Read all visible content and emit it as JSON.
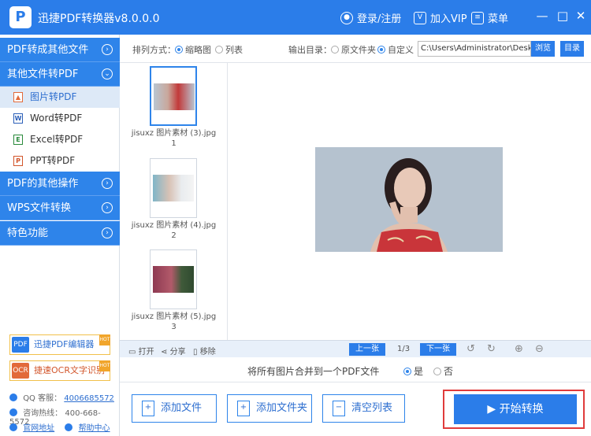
{
  "titlebar": {
    "logo_letter": "P",
    "title": "迅捷PDF转换器v8.0.0.0",
    "login": "登录/注册",
    "vip": "加入VIP",
    "menu": "菜单",
    "win_min": "—",
    "win_max": "□",
    "win_close": "✕"
  },
  "sidebar": {
    "categories": [
      {
        "label": "PDF转成其他文件",
        "chev": "›"
      },
      {
        "label": "其他文件转PDF",
        "chev": "⌄"
      },
      {
        "label": "PDF的其他操作",
        "chev": "›"
      },
      {
        "label": "WPS文件转换",
        "chev": "›"
      },
      {
        "label": "特色功能",
        "chev": "›"
      }
    ],
    "subitems": [
      {
        "label": "图片转PDF",
        "icon": "▲"
      },
      {
        "label": "Word转PDF",
        "icon": "W"
      },
      {
        "label": "Excel转PDF",
        "icon": "E"
      },
      {
        "label": "PPT转PDF",
        "icon": "P"
      }
    ],
    "promos": [
      {
        "label": "迅捷PDF编辑器",
        "icon": "PDF",
        "badge": "HOT"
      },
      {
        "label": "捷速OCR文字识别",
        "icon": "OCR",
        "badge": "HOT"
      }
    ],
    "contact": {
      "qq_label": "QQ 客服：",
      "qq_value": "4006685572",
      "phone_label": "咨询热线：",
      "phone_value": "400-668-5572",
      "site": "官网地址",
      "help": "帮助中心"
    }
  },
  "options": {
    "sort_label": "排列方式：",
    "sort_thumb": "缩略图",
    "sort_list": "列表",
    "out_label": "输出目录：",
    "out_orig": "原文件夹",
    "out_custom": "自定义",
    "path": "C:\\Users\\Administrator\\Desktop",
    "browse": "浏览",
    "dir": "目录"
  },
  "files": [
    {
      "name": "jisuxz 图片素材 (3).jpg",
      "index": "1"
    },
    {
      "name": "jisuxz 图片素材 (4).jpg",
      "index": "2"
    },
    {
      "name": "jisuxz 图片素材 (5).jpg",
      "index": "3"
    }
  ],
  "thumb_tools": {
    "open": "打开",
    "share": "分享",
    "remove": "移除"
  },
  "pager": {
    "prev": "上一张",
    "page": "1/3",
    "next": "下一张"
  },
  "merge": {
    "label": "将所有图片合并到一个PDF文件",
    "yes": "是",
    "no": "否"
  },
  "actions": {
    "add_file": "添加文件",
    "add_folder": "添加文件夹",
    "clear": "清空列表",
    "start": "开始转换"
  },
  "colors": {
    "accent": "#2b7de9",
    "highlight": "#e03b3b"
  }
}
